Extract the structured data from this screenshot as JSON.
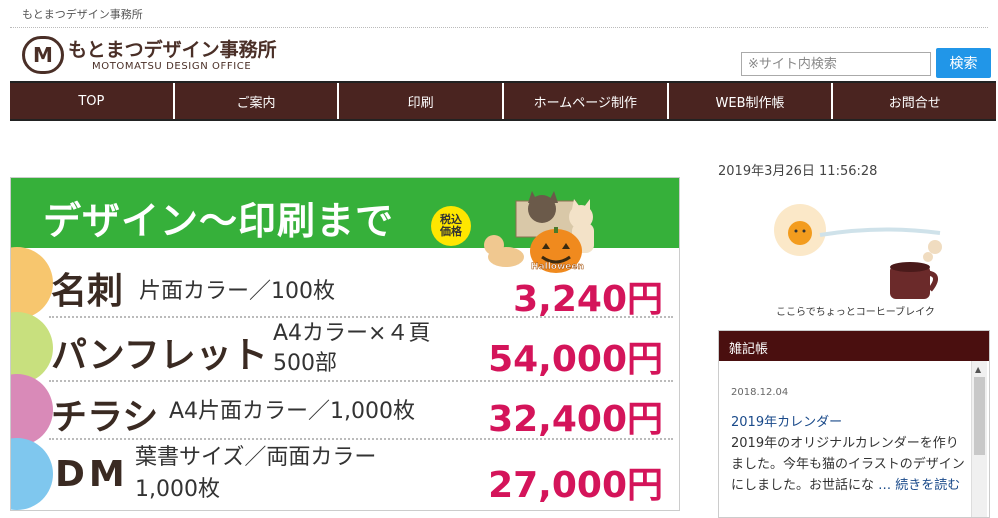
{
  "header": {
    "top_text": "もとまつデザイン事務所",
    "logo_mark": "M",
    "logo_jp": "もとまつデザイン事務所",
    "logo_en": "MOTOMATSU DESIGN OFFICE"
  },
  "search": {
    "placeholder": "※サイト内検索",
    "button_label": "検索"
  },
  "nav": {
    "items": [
      "TOP",
      "ご案内",
      "印刷",
      "ホームページ制作",
      "WEB制作帳",
      "お問合せ"
    ]
  },
  "banner": {
    "title": "デザイン〜印刷まで",
    "tax_line1": "税込",
    "tax_line2": "価格",
    "halloween_text": "Halloween",
    "rows": [
      {
        "name": "名刺",
        "desc1": "片面カラー／100枚",
        "desc2": "",
        "price": "3,240円"
      },
      {
        "name": "パンフレット",
        "desc1": "A4カラー×４頁",
        "desc2": "500部",
        "price": "54,000円"
      },
      {
        "name": "チラシ",
        "desc1": "A4片面カラー／1,000枚",
        "desc2": "",
        "price": "32,400円"
      },
      {
        "name": "DM",
        "desc1": "葉書サイズ／両面カラー",
        "desc2": "1,000枚",
        "price": "27,000円"
      }
    ],
    "colors": [
      "#f7c66e",
      "#c8e07e",
      "#d98ab8",
      "#7fc7ee"
    ]
  },
  "sidebar": {
    "datetime": "2019年3月26日  11:56:28",
    "coffee_caption": "ここらでちょっとコーヒーブレイク",
    "diary": {
      "title": "雑記帳",
      "date": "2018.12.04",
      "link": "2019年カレンダー",
      "body": "2019年のオリジナルカレンダーを作りました。今年も猫のイラストのデザインにしました。お世話にな",
      "more": "… 続きを読む"
    }
  }
}
